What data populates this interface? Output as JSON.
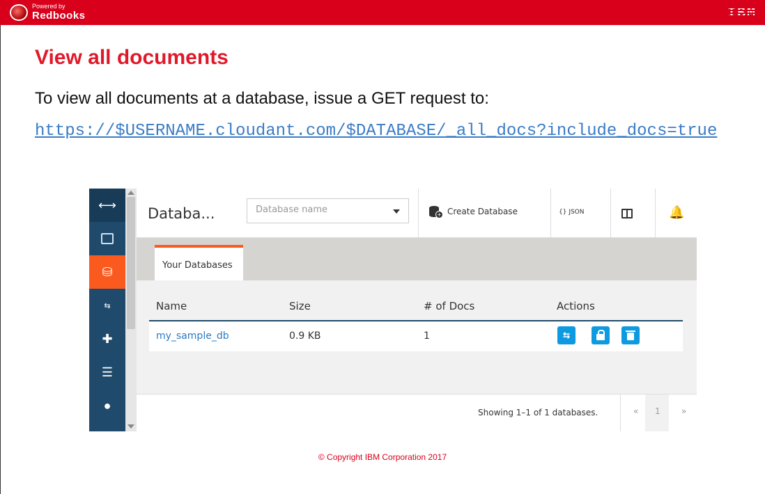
{
  "header": {
    "powered_by": "Powered by",
    "brand": "Redbooks",
    "ibm": "IBM"
  },
  "slide": {
    "title": "View all documents",
    "intro": "To view all documents at a database, issue a GET request to:",
    "url": "https://$USERNAME.cloudant.com/$DATABASE/_all_docs?include_docs=true"
  },
  "app": {
    "title": "Databa...",
    "db_select_placeholder": "Database name",
    "create_label": "Create Database",
    "json_label": "{} JSON",
    "sidebar_icons": [
      "collapse-icon",
      "chart-icon",
      "database-icon",
      "replication-icon",
      "puzzle-icon",
      "server-icon",
      "user-icon"
    ],
    "tab_label": "Your Databases",
    "table": {
      "headers": [
        "Name",
        "Size",
        "# of Docs",
        "Actions"
      ],
      "rows": [
        {
          "name": "my_sample_db",
          "size": "0.9 KB",
          "docs": "1"
        }
      ]
    },
    "pagination": {
      "showing": "Showing 1–1 of 1 databases.",
      "prev": "«",
      "page": "1",
      "next": "»"
    },
    "colors": {
      "sidebar": "#1f4a6b",
      "active": "#fb5a1f",
      "action_button": "#0e9ae0",
      "link": "#2a7bc0"
    }
  },
  "footer": {
    "copyright": "© Copyright IBM Corporation 2017"
  }
}
